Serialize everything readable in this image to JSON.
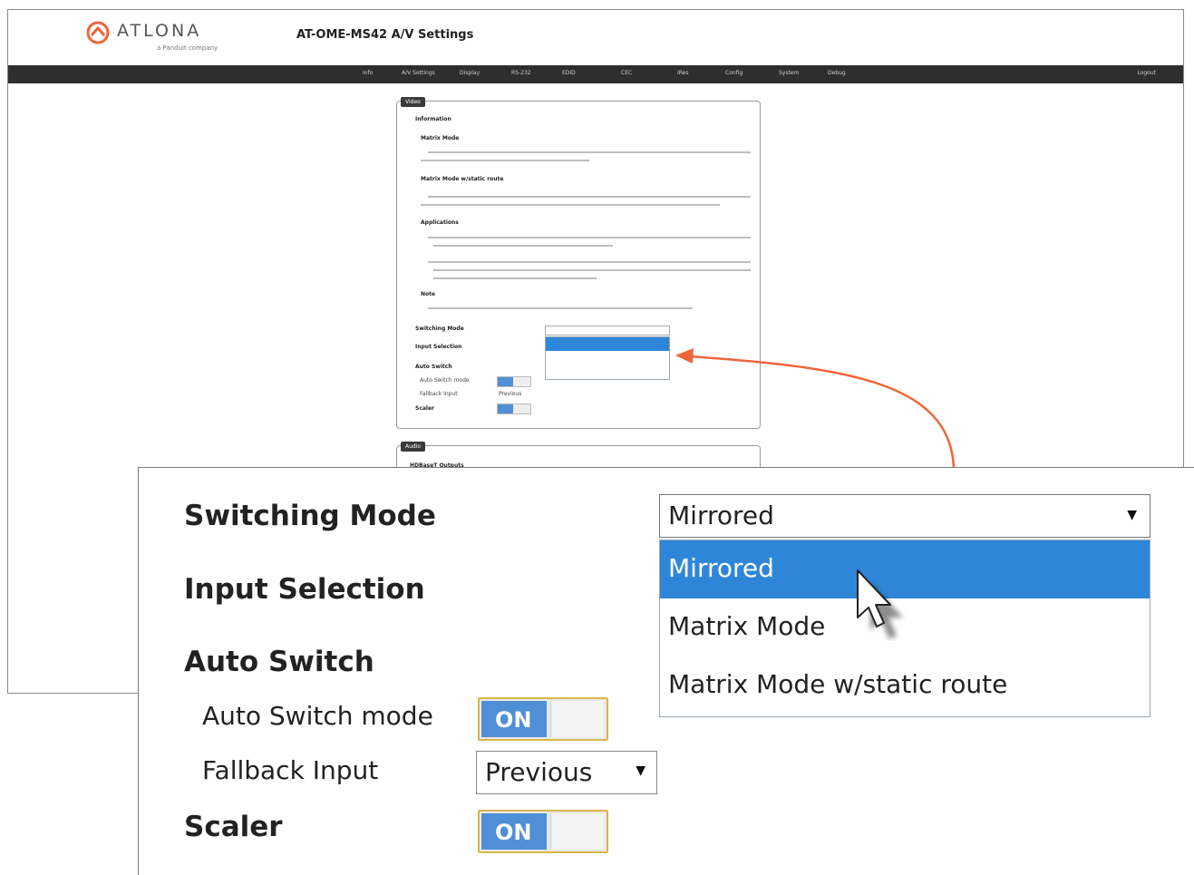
{
  "app": {
    "logo_text": "ATLONA",
    "logo_tagline": "a Panduit company",
    "page_title": "AT-OME-MS42  A/V Settings",
    "brand_color": "#f0643a"
  },
  "nav": {
    "items": [
      "Info",
      "A/V Settings",
      "Display",
      "RS-232",
      "EDID",
      "CEC",
      "IRes",
      "Config",
      "System",
      "Debug"
    ],
    "logout": "Logout",
    "bar_color": "#2e2e2e"
  },
  "video_panel": {
    "tab": "Video",
    "information": "Information",
    "matrix_mode": "Matrix Mode",
    "matrix_static": "Matrix Mode w/static route",
    "applications": "Applications",
    "note": "Note",
    "switching_mode": "Switching Mode",
    "input_selection": "Input Selection",
    "auto_switch": "Auto Switch",
    "auto_switch_mode": "Auto Switch mode",
    "fallback_input": "Fallback Input",
    "fallback_value": "Previous",
    "scaler": "Scaler"
  },
  "audio_panel": {
    "tab": "Audio",
    "subtitle": "HDBaseT Outputs"
  },
  "zoom": {
    "switching_mode_label": "Switching Mode",
    "switching_mode_value": "Mirrored",
    "options": [
      "Mirrored",
      "Matrix Mode",
      "Matrix Mode w/static route"
    ],
    "selected_option": "Mirrored",
    "input_selection_label": "Input Selection",
    "auto_switch_label": "Auto Switch",
    "auto_switch_mode_label": "Auto Switch mode",
    "auto_switch_mode_state": "ON",
    "fallback_input_label": "Fallback Input",
    "fallback_input_value": "Previous",
    "scaler_label": "Scaler",
    "scaler_state": "ON",
    "highlight_color": "#2f86d8",
    "toggle_on_color": "#4f8fd6"
  },
  "icons": {
    "dropdown_caret": "▼",
    "cursor": "mouse-pointer-icon",
    "arrow": "orange-callout-arrow"
  }
}
